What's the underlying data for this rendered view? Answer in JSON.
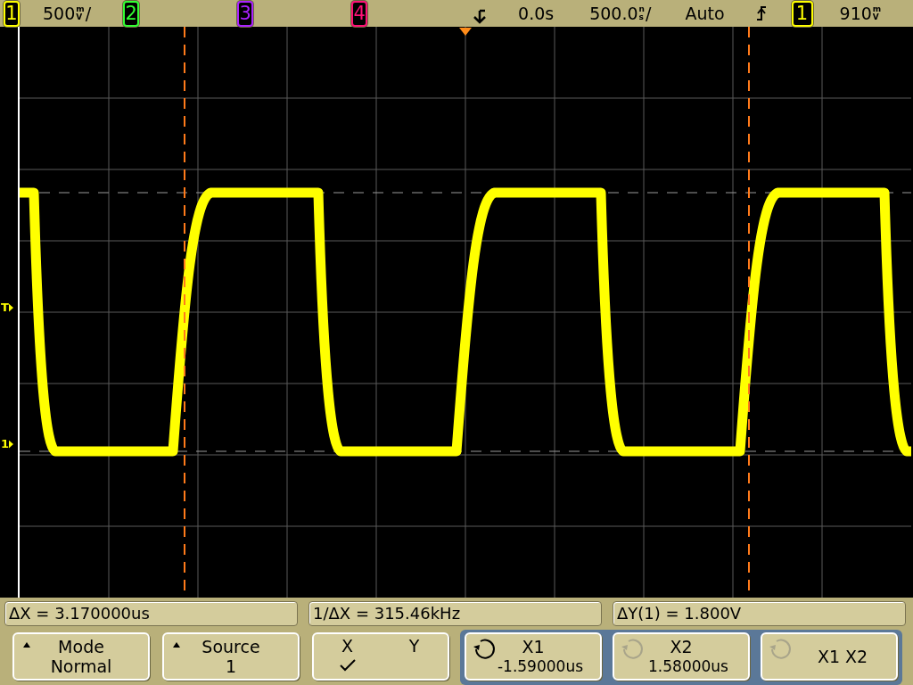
{
  "top_bar": {
    "channels": [
      {
        "label": "1",
        "color": "#ffff00",
        "scale": {
          "value": "500",
          "unit": [
            "m",
            "V"
          ],
          "suffix": "/"
        }
      },
      {
        "label": "2",
        "color": "#33ff33"
      },
      {
        "label": "3",
        "color": "#aa22ff"
      },
      {
        "label": "4",
        "color": "#ff1177"
      }
    ],
    "delay": "0.0s",
    "timebase": {
      "value": "500.0",
      "unit": [
        "n",
        "s"
      ],
      "suffix": "/"
    },
    "trigger_mode": "Auto",
    "trigger_source": {
      "label": "1",
      "color": "#ffff00"
    },
    "trigger_level": {
      "value": "910",
      "unit": [
        "m",
        "V"
      ]
    }
  },
  "display": {
    "trigger_marker": "T",
    "ground_marker": "1"
  },
  "readouts": [
    "ΔX = 3.170000us",
    "1/ΔX = 315.46kHz",
    "ΔY(1) = 1.800V"
  ],
  "softkeys": [
    {
      "kind": "menu",
      "title": "Mode",
      "value": "Normal"
    },
    {
      "kind": "menu",
      "title": "Source",
      "value": "1"
    },
    {
      "kind": "toggle",
      "options": [
        {
          "label": "X",
          "selected": true
        },
        {
          "label": "Y",
          "selected": false
        }
      ]
    },
    {
      "kind": "knob",
      "title": "X1",
      "value": "-1.59000us",
      "active": true
    },
    {
      "kind": "knob",
      "title": "X2",
      "value": "1.58000us",
      "active": false
    },
    {
      "kind": "knob",
      "title": "X1 X2",
      "active": false
    }
  ]
}
